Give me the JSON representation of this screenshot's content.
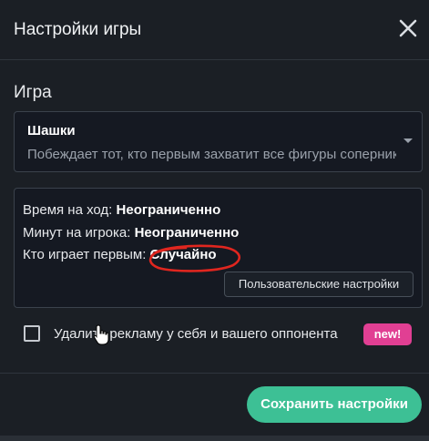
{
  "dialog": {
    "title": "Настройки игры",
    "close_icon": "close-icon"
  },
  "game": {
    "section_label": "Игра",
    "selected_name": "Шашки",
    "selected_description": "Побеждает тот, кто первым захватит все фигуры соперника",
    "dropdown_icon": "chevron-down-icon"
  },
  "settings": {
    "time_label": "Время на ход: ",
    "time_value": "Неограниченно",
    "minutes_label": "Минут на игрока: ",
    "minutes_value": "Неограниченно",
    "first_label": "Кто играет первым: ",
    "first_value": "Случайно",
    "custom_button": "Пользовательские настройки"
  },
  "ads": {
    "checked": false,
    "label": "Удалить рекламу у себя и вашего оппонента",
    "badge": "new!"
  },
  "footer": {
    "save_button": "Сохранить настройки"
  },
  "colors": {
    "background": "#1b1f25",
    "accent": "#3dc095",
    "badge": "#e13f93",
    "annotation": "#e0261f"
  }
}
